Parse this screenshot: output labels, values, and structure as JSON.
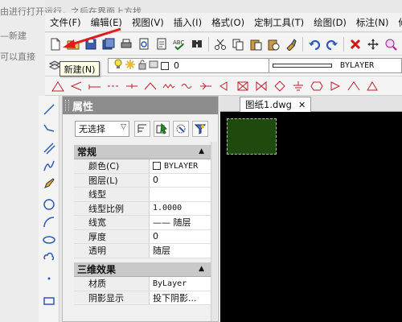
{
  "background": {
    "lines": [
      "由进行打开运行，之后在界面上方找",
      "—新建",
      "可以直接"
    ]
  },
  "menubar": {
    "items": [
      "文件(F)",
      "编辑(E)",
      "视图(V)",
      "插入(I)",
      "格式(O)",
      "定制工具(T)",
      "绘图(D)",
      "标注(N)",
      "修"
    ]
  },
  "toolbar": {
    "tooltip": "新建(N)",
    "layer_value": "0",
    "lineweight_value": "BYLAYER"
  },
  "properties": {
    "title": "属性",
    "selection": "无选择",
    "sections": [
      {
        "title": "常规",
        "rows": [
          {
            "name": "颜色(C)",
            "value": "BYLAYER"
          },
          {
            "name": "图层(L)",
            "value": "0"
          },
          {
            "name": "线型",
            "value": ""
          },
          {
            "name": "线型比例",
            "value": "1.0000"
          },
          {
            "name": "线宽",
            "value": "—— 随层"
          },
          {
            "name": "厚度",
            "value": "0"
          },
          {
            "name": "透明",
            "value": "随层"
          }
        ]
      },
      {
        "title": "三维效果",
        "rows": [
          {
            "name": "材质",
            "value": "ByLayer"
          },
          {
            "name": "阴影显示",
            "value": "投下阴影..."
          }
        ]
      }
    ]
  },
  "document": {
    "tab_label": "图纸1.dwg",
    "close_symbol": "✕"
  },
  "colors": {
    "canvas_bg": "#000000",
    "rect_fill": "#1f4a0e",
    "panel_header": "#8c8c8c",
    "annotation_arrow": "#e01b1b"
  }
}
